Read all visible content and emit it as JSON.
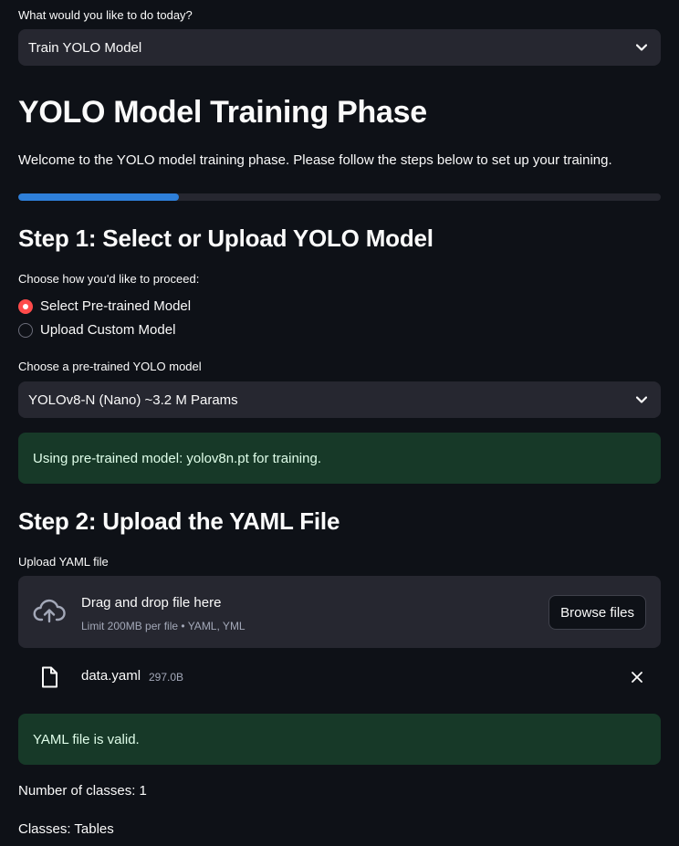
{
  "action_select": {
    "label": "What would you like to do today?",
    "value": "Train YOLO Model"
  },
  "header": {
    "title": "YOLO Model Training Phase",
    "welcome": "Welcome to the YOLO model training phase. Please follow the steps below to set up your training."
  },
  "progress": {
    "value": 0.25
  },
  "step1": {
    "heading": "Step 1: Select or Upload YOLO Model",
    "radio_label": "Choose how you'd like to proceed:",
    "options": [
      "Select Pre-trained Model",
      "Upload Custom Model"
    ],
    "selected_option": "Select Pre-trained Model",
    "model_select_label": "Choose a pre-trained YOLO model",
    "model_select_value": "YOLOv8-N (Nano) ~3.2 M Params",
    "success_message": "Using pre-trained model: yolov8n.pt for training."
  },
  "step2": {
    "heading": "Step 2: Upload the YAML File",
    "uploader_label": "Upload YAML file",
    "dropzone_title": "Drag and drop file here",
    "dropzone_subtitle": "Limit 200MB per file • YAML, YML",
    "browse_label": "Browse files",
    "file": {
      "name": "data.yaml",
      "size": "297.0B"
    },
    "valid_message": "YAML file is valid.",
    "num_classes_text": "Number of classes: 1",
    "classes_text": "Classes: Tables"
  },
  "colors": {
    "background": "#0e1117",
    "widget": "#262730",
    "accent": "#ff4b4b",
    "progress": "#2e7fd9",
    "success_bg": "#173928",
    "success_text": "#dffde9"
  },
  "icons": {
    "select_chevron": "chevron-down-icon",
    "upload": "cloud-upload-icon",
    "file": "file-icon",
    "remove": "close-icon"
  }
}
